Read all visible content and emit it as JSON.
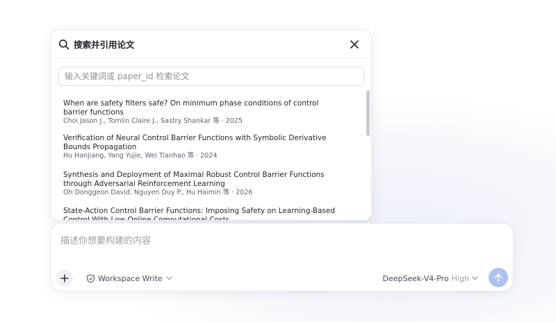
{
  "citation_panel": {
    "title": "搜索并引用论文",
    "search_placeholder": "输入关键词或 paper_id 检索论文",
    "results": [
      {
        "title": "When are safety filters safe? On minimum phase conditions of control barrier functions",
        "meta": "Choi Jason J., Tomlin Claire J., Sastry Shankar 等 · 2025"
      },
      {
        "title": "Verification of Neural Control Barrier Functions with Symbolic Derivative Bounds Propagation",
        "meta": "Hu Hanjiang, Yang Yujie, Wei Tianhao 等 · 2024"
      },
      {
        "title": "Synthesis and Deployment of Maximal Robust Control Barrier Functions through Adversarial Reinforcement Learning",
        "meta": "Oh Donggeon David, Nguyen Duy P., Hu Haimin 等 · 2026"
      },
      {
        "title": "State-Action Control Barrier Functions: Imposing Safety on Learning-Based Control With Low Online Computational Costs",
        "meta": ""
      }
    ]
  },
  "composer": {
    "placeholder": "描述你想要构建的内容",
    "mode_label": "Workspace Write",
    "model_name": "DeepSeek-V4-Pro",
    "model_effort": "High"
  },
  "icons": {
    "search": "search-icon",
    "close": "close-icon",
    "add": "plus-icon",
    "mode": "shield-check-icon",
    "chevron": "chevron-down-icon",
    "send": "arrow-up-icon"
  },
  "colors": {
    "send_button": "#aec2f2",
    "panel_border": "#e6e8ee"
  }
}
